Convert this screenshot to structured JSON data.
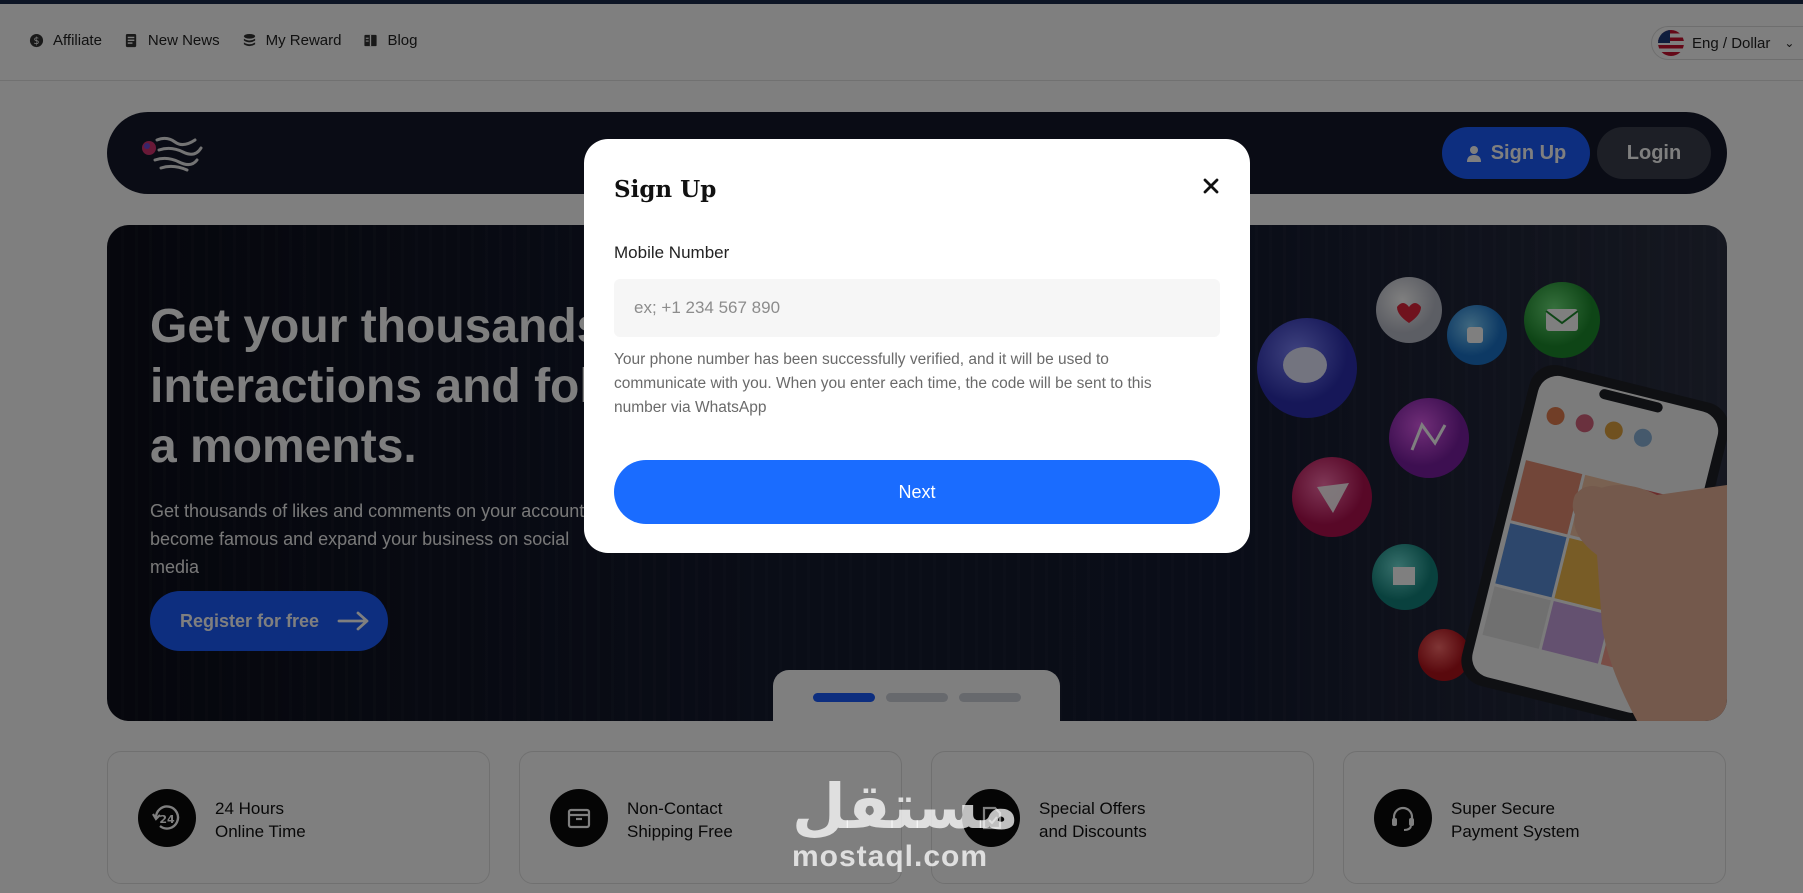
{
  "topnav": {
    "items": [
      {
        "label": "Affiliate",
        "icon": "dollar-coin-icon"
      },
      {
        "label": "New News",
        "icon": "news-icon"
      },
      {
        "label": "My Reward",
        "icon": "coins-stack-icon"
      },
      {
        "label": "Blog",
        "icon": "book-icon"
      }
    ],
    "language": "Eng / Dollar",
    "language_chevron": "⌄"
  },
  "header": {
    "signup_label": "Sign Up",
    "login_label": "Login"
  },
  "hero": {
    "title": "Get your thousands of interactions and followers in just a moments.",
    "subtitle": "Get thousands of likes and comments on your account, become famous and expand your business on social media",
    "register_label": "Register for free",
    "slide_count": 3,
    "active_slide": 1
  },
  "features": [
    {
      "line1": "24 Hours",
      "line2": "Online Time",
      "icon": "clock-24-icon"
    },
    {
      "line1": "Non-Contact",
      "line2": "Shipping Free",
      "icon": "box-icon"
    },
    {
      "line1": "Special Offers",
      "line2": "and Discounts",
      "icon": "discount-tag-icon"
    },
    {
      "line1": "Super Secure",
      "line2": "Payment System",
      "icon": "headset-icon"
    }
  ],
  "watermark": {
    "arabic": "مستقل",
    "latin": "mostaql.com"
  },
  "modal": {
    "title": "Sign Up",
    "close_label": "✕",
    "field_label": "Mobile Number",
    "field_placeholder": "ex; +1 234 567 890",
    "field_value": "",
    "note": "Your phone number has been successfully verified, and it will be used to communicate with you. When you enter each time, the code will be sent to this number via WhatsApp",
    "next_label": "Next"
  },
  "colors": {
    "accent": "#1a6cff",
    "header_bg": "#15192b",
    "overlay": "rgba(0,0,0,0.5)"
  }
}
